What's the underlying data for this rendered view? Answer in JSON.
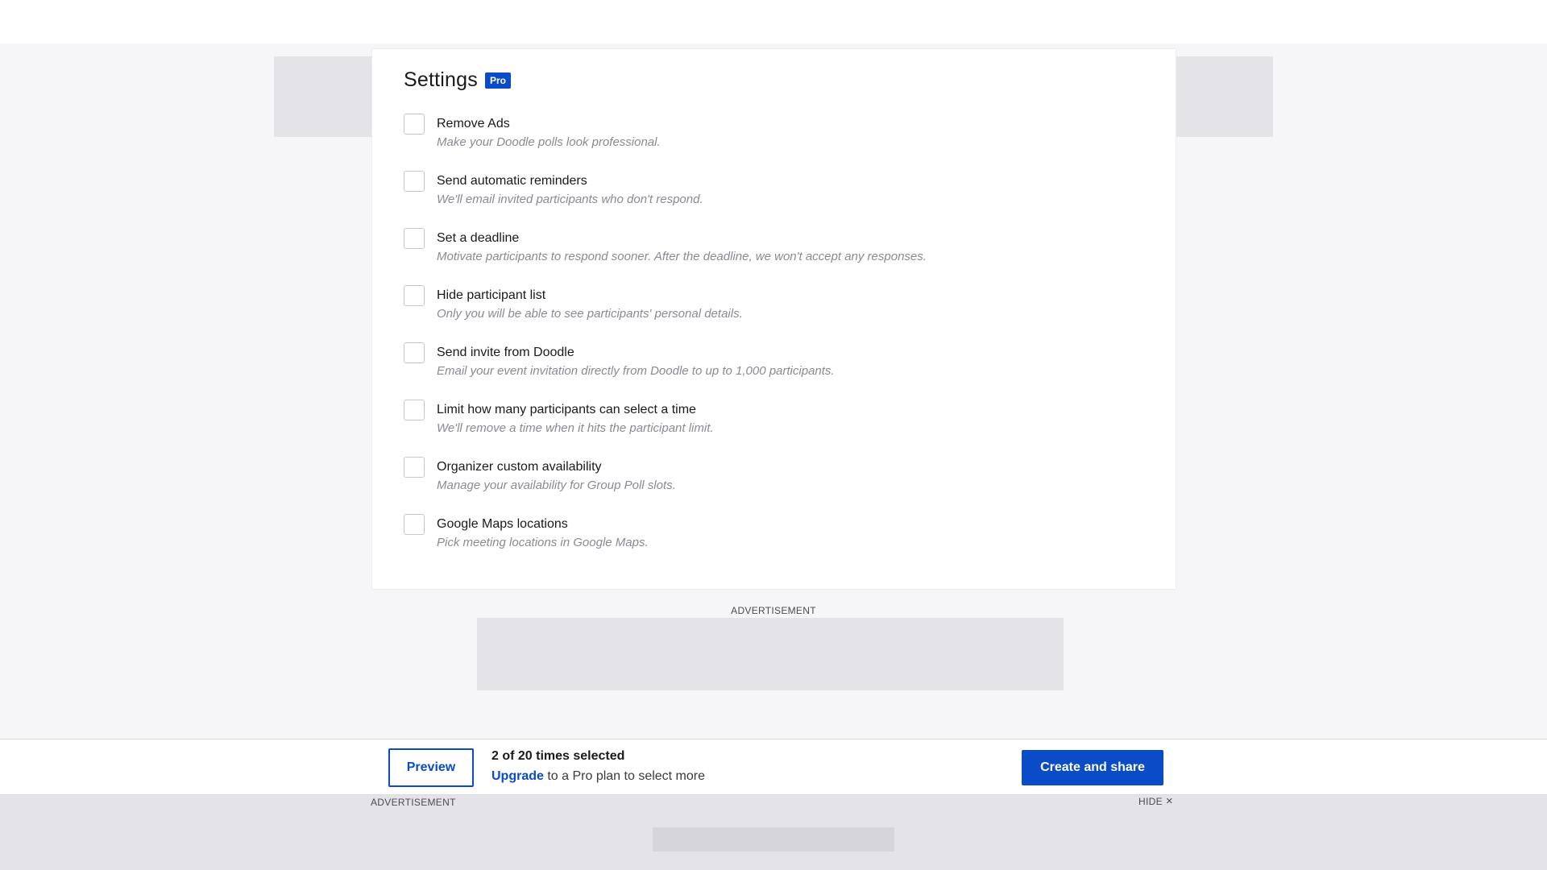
{
  "settings": {
    "title": "Settings",
    "badge": "Pro",
    "options": [
      {
        "label": "Remove Ads",
        "description": "Make your Doodle polls look professional."
      },
      {
        "label": "Send automatic reminders",
        "description": "We'll email invited participants who don't respond."
      },
      {
        "label": "Set a deadline",
        "description": "Motivate participants to respond sooner. After the deadline, we won't accept any responses."
      },
      {
        "label": "Hide participant list",
        "description": "Only you will be able to see participants' personal details."
      },
      {
        "label": "Send invite from Doodle",
        "description": "Email your event invitation directly from Doodle to up to 1,000 participants."
      },
      {
        "label": "Limit how many participants can select a time",
        "description": "We'll remove a time when it hits the participant limit."
      },
      {
        "label": "Organizer custom availability",
        "description": "Manage your availability for Group Poll slots."
      },
      {
        "label": "Google Maps locations",
        "description": "Pick meeting locations in Google Maps."
      }
    ]
  },
  "ads": {
    "mid_label": "ADVERTISEMENT",
    "bottom_label": "ADVERTISEMENT",
    "hide_label": "HIDE",
    "hide_icon": "close-icon"
  },
  "footer": {
    "preview_label": "Preview",
    "times_selected": "2 of 20 times selected",
    "upgrade_link": "Upgrade",
    "upgrade_text": " to a Pro plan to select more",
    "create_label": "Create and share"
  },
  "colors": {
    "accent": "#0a4bc8",
    "ad_placeholder": "#e4e4e8",
    "description_text": "#8a8a92"
  }
}
